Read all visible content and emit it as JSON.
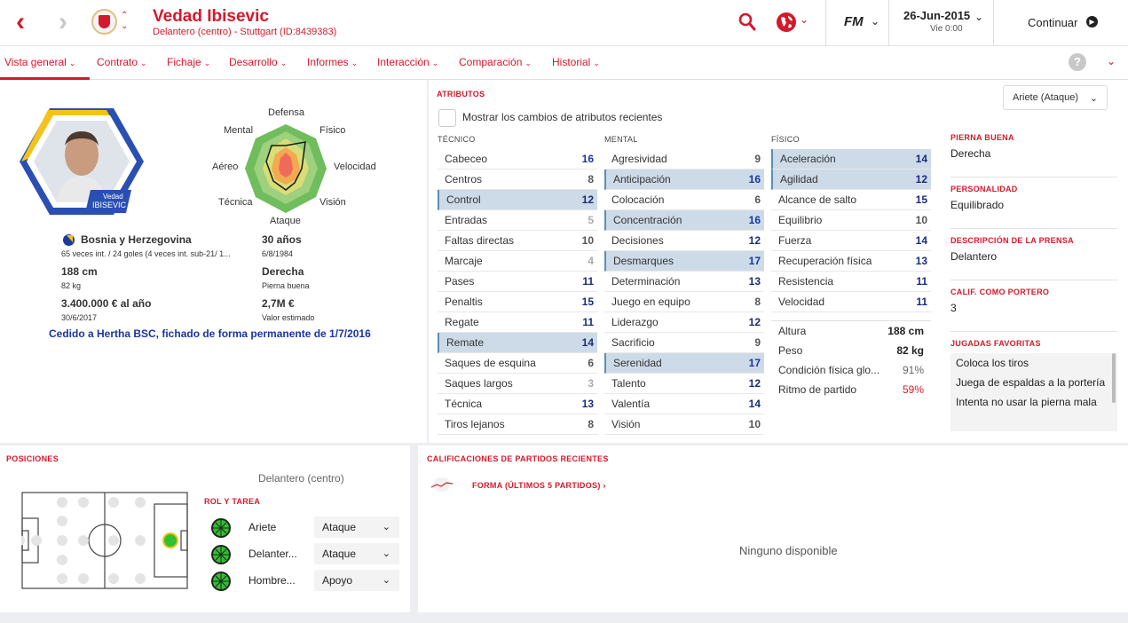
{
  "header": {
    "player_name": "Vedad Ibisevic",
    "player_sub": "Delantero (centro) - Stuttgart (ID:8439383)",
    "date": "26-Jun-2015",
    "time": "Vie 0:00",
    "continue_label": "Continuar",
    "fm_logo": "FM",
    "icons": [
      "back-arrow-icon",
      "forward-arrow-icon",
      "club-crest-icon",
      "search-icon",
      "globe-icon",
      "continue-icon"
    ]
  },
  "tabs": [
    {
      "label": "Vista general"
    },
    {
      "label": "Contrato"
    },
    {
      "label": "Fichaje"
    },
    {
      "label": "Desarrollo"
    },
    {
      "label": "Informes"
    },
    {
      "label": "Interacción"
    },
    {
      "label": "Comparación"
    },
    {
      "label": "Historial"
    }
  ],
  "help_label": "?",
  "profile": {
    "card_name_first": "Vedad",
    "card_name_last": "IBISEVIC",
    "nation": "Bosnia y Herzegovina",
    "caps": "65 veces int. / 24 goles (4 veces int. sub-21/ 1...",
    "age": "30 años",
    "dob": "6/8/1984",
    "height": "188 cm",
    "weight": "82 kg",
    "foot": "Derecha",
    "foot_label": "Pierna buena",
    "wage": "3.400.000 € al año",
    "contract_end": "30/6/2017",
    "value": "2,7M €",
    "value_label": "Valor estimado",
    "loan_note": "Cedido a Hertha BSC, fichado de forma permanente de 1/7/2016",
    "radar": [
      "Defensa",
      "Físico",
      "Velocidad",
      "Visión",
      "Ataque",
      "Técnica",
      "Aéreo",
      "Mental"
    ]
  },
  "attributes": {
    "title": "ATRIBUTOS",
    "show_changes": "Mostrar los cambios de atributos recientes",
    "role_select": "Ariete (Ataque)",
    "tecnico_title": "TÉCNICO",
    "mental_title": "MENTAL",
    "fisico_title": "FÍSICO",
    "tecnico": [
      {
        "name": "Cabeceo",
        "value": "16",
        "hl": false
      },
      {
        "name": "Centros",
        "value": "8",
        "hl": false
      },
      {
        "name": "Control",
        "value": "12",
        "hl": true
      },
      {
        "name": "Entradas",
        "value": "5",
        "hl": false
      },
      {
        "name": "Faltas directas",
        "value": "10",
        "hl": false
      },
      {
        "name": "Marcaje",
        "value": "4",
        "hl": false
      },
      {
        "name": "Pases",
        "value": "11",
        "hl": false
      },
      {
        "name": "Penaltis",
        "value": "15",
        "hl": false
      },
      {
        "name": "Regate",
        "value": "11",
        "hl": false
      },
      {
        "name": "Remate",
        "value": "14",
        "hl": true
      },
      {
        "name": "Saques de esquina",
        "value": "6",
        "hl": false
      },
      {
        "name": "Saques largos",
        "value": "3",
        "hl": false
      },
      {
        "name": "Técnica",
        "value": "13",
        "hl": false
      },
      {
        "name": "Tiros lejanos",
        "value": "8",
        "hl": false
      }
    ],
    "mental": [
      {
        "name": "Agresividad",
        "value": "9",
        "hl": false
      },
      {
        "name": "Anticipación",
        "value": "16",
        "hl": true
      },
      {
        "name": "Colocación",
        "value": "6",
        "hl": false
      },
      {
        "name": "Concentración",
        "value": "16",
        "hl": true
      },
      {
        "name": "Decisiones",
        "value": "12",
        "hl": false
      },
      {
        "name": "Desmarques",
        "value": "17",
        "hl": true
      },
      {
        "name": "Determinación",
        "value": "13",
        "hl": false
      },
      {
        "name": "Juego en equipo",
        "value": "8",
        "hl": false
      },
      {
        "name": "Liderazgo",
        "value": "12",
        "hl": false
      },
      {
        "name": "Sacrificio",
        "value": "9",
        "hl": false
      },
      {
        "name": "Serenidad",
        "value": "17",
        "hl": true
      },
      {
        "name": "Talento",
        "value": "12",
        "hl": false
      },
      {
        "name": "Valentía",
        "value": "14",
        "hl": false
      },
      {
        "name": "Visión",
        "value": "10",
        "hl": false
      }
    ],
    "fisico": [
      {
        "name": "Aceleración",
        "value": "14",
        "hl": true
      },
      {
        "name": "Agilidad",
        "value": "12",
        "hl": true
      },
      {
        "name": "Alcance de salto",
        "value": "15",
        "hl": false
      },
      {
        "name": "Equilibrio",
        "value": "10",
        "hl": false
      },
      {
        "name": "Fuerza",
        "value": "14",
        "hl": false
      },
      {
        "name": "Recuperación física",
        "value": "13",
        "hl": false
      },
      {
        "name": "Resistencia",
        "value": "11",
        "hl": false
      },
      {
        "name": "Velocidad",
        "value": "11",
        "hl": false
      }
    ],
    "physical_info": [
      {
        "name": "Altura",
        "value": "188 cm"
      },
      {
        "name": "Peso",
        "value": "82 kg"
      },
      {
        "name": "Condición física glo...",
        "value": "91%"
      },
      {
        "name": "Ritmo de partido",
        "value": "59%"
      }
    ]
  },
  "side": {
    "foot_title": "PIERNA BUENA",
    "foot": "Derecha",
    "personality_title": "PERSONALIDAD",
    "personality": "Equilibrado",
    "press_title": "DESCRIPCIÓN DE LA PRENSA",
    "press": "Delantero",
    "gk_title": "CALIF. COMO PORTERO",
    "gk": "3",
    "moves_title": "JUGADAS FAVORITAS",
    "moves": [
      "Coloca los tiros",
      "Juega de espaldas a la portería",
      "Intenta no usar la pierna mala"
    ]
  },
  "positions": {
    "title": "POSICIONES",
    "position_name": "Delantero (centro)",
    "role_title": "ROL Y TAREA",
    "roles": [
      {
        "name": "Ariete",
        "duty": "Ataque"
      },
      {
        "name": "Delanter...",
        "duty": "Ataque"
      },
      {
        "name": "Hombre...",
        "duty": "Apoyo"
      }
    ]
  },
  "ratings": {
    "title": "CALIFICACIONES DE PARTIDOS RECIENTES",
    "form_label": "FORMA (ÚLTIMOS 5 PARTIDOS) ›",
    "no_data": "Ninguno disponible"
  },
  "colors": {
    "accent": "#d4192b",
    "highlight": "#cddbe8",
    "high_value": "#1a35a3"
  }
}
